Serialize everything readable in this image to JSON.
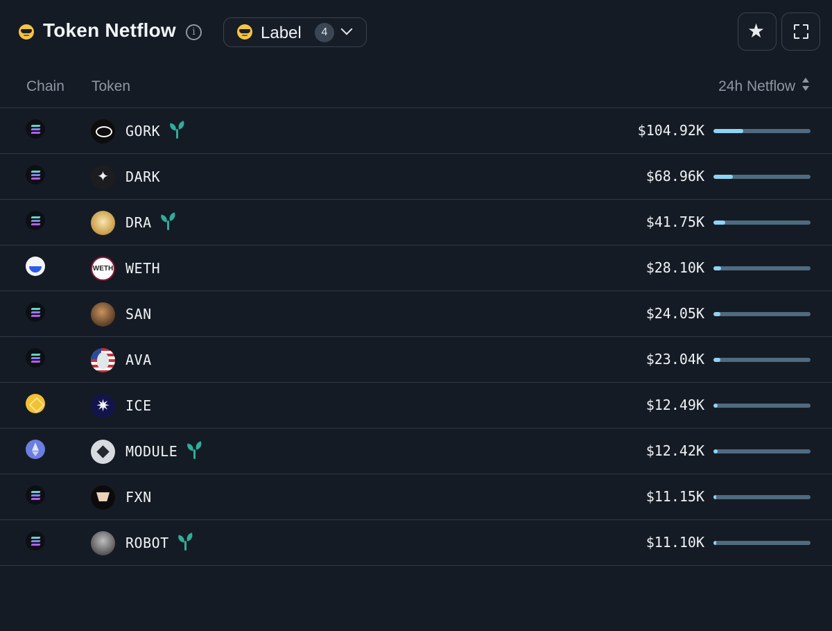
{
  "header": {
    "title": "Token Netflow",
    "title_icon": "sunglasses-emoji-icon",
    "info_icon": "info-circle-icon",
    "filter": {
      "label": "Label",
      "count": "4",
      "icon": "sunglasses-emoji-icon",
      "chevron": "chevron-down-icon"
    },
    "actions": [
      {
        "icon": "star-icon"
      },
      {
        "icon": "fullscreen-icon"
      }
    ]
  },
  "table": {
    "columns": {
      "chain": "Chain",
      "token": "Token",
      "netflow": "24h Netflow"
    },
    "rows": [
      {
        "chain": "solana",
        "token": "GORK",
        "new": true,
        "netflow": "$104.92K",
        "fraction": 0.31
      },
      {
        "chain": "solana",
        "token": "DARK",
        "new": false,
        "netflow": "$68.96K",
        "fraction": 0.2
      },
      {
        "chain": "solana",
        "token": "DRA",
        "new": true,
        "netflow": "$41.75K",
        "fraction": 0.12
      },
      {
        "chain": "base",
        "token": "WETH",
        "new": false,
        "netflow": "$28.10K",
        "fraction": 0.08
      },
      {
        "chain": "solana",
        "token": "SAN",
        "new": false,
        "netflow": "$24.05K",
        "fraction": 0.07
      },
      {
        "chain": "solana",
        "token": "AVA",
        "new": false,
        "netflow": "$23.04K",
        "fraction": 0.07
      },
      {
        "chain": "bsc",
        "token": "ICE",
        "new": false,
        "netflow": "$12.49K",
        "fraction": 0.04
      },
      {
        "chain": "ethereum",
        "token": "MODULE",
        "new": true,
        "netflow": "$12.42K",
        "fraction": 0.04
      },
      {
        "chain": "solana",
        "token": "FXN",
        "new": false,
        "netflow": "$11.15K",
        "fraction": 0.03
      },
      {
        "chain": "solana",
        "token": "ROBOT",
        "new": true,
        "netflow": "$11.10K",
        "fraction": 0.03
      }
    ]
  },
  "colors": {
    "background": "#151b24",
    "bar_fill": "#8fd3f4",
    "bar_track": "#4f6b80",
    "new_badge": "#2fae9a",
    "border": "#2f3844"
  }
}
